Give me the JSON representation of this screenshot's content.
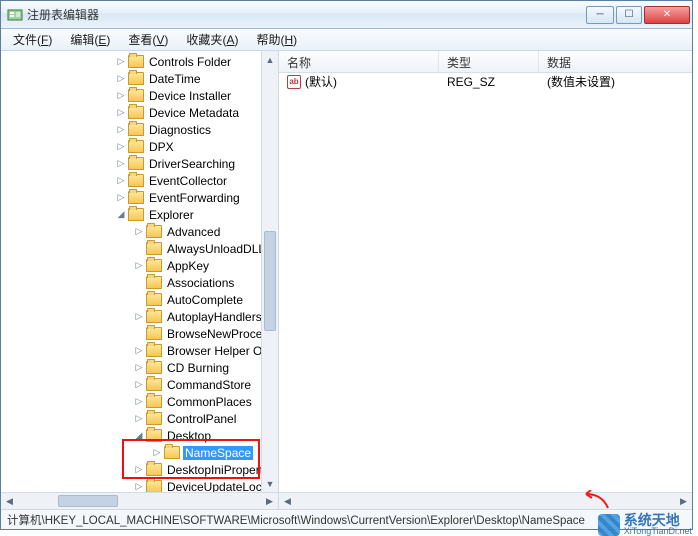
{
  "title": "注册表编辑器",
  "menu": {
    "file": {
      "label": "文件",
      "key": "F"
    },
    "edit": {
      "label": "编辑",
      "key": "E"
    },
    "view": {
      "label": "查看",
      "key": "V"
    },
    "fav": {
      "label": "收藏夹",
      "key": "A"
    },
    "help": {
      "label": "帮助",
      "key": "H"
    }
  },
  "columns": {
    "name": "名称",
    "type": "类型",
    "data": "数据"
  },
  "row0": {
    "name": "(默认)",
    "type": "REG_SZ",
    "data": "(数值未设置)",
    "icon": "ab"
  },
  "tree": {
    "items": [
      {
        "label": "Controls Folder",
        "exp": "▷"
      },
      {
        "label": "DateTime",
        "exp": "▷"
      },
      {
        "label": "Device Installer",
        "exp": "▷"
      },
      {
        "label": "Device Metadata",
        "exp": "▷"
      },
      {
        "label": "Diagnostics",
        "exp": "▷"
      },
      {
        "label": "DPX",
        "exp": "▷"
      },
      {
        "label": "DriverSearching",
        "exp": "▷"
      },
      {
        "label": "EventCollector",
        "exp": "▷"
      },
      {
        "label": "EventForwarding",
        "exp": "▷"
      },
      {
        "label": "Explorer",
        "exp": "◢",
        "expanded": true
      }
    ],
    "explorer_children": [
      {
        "label": "Advanced",
        "exp": "▷"
      },
      {
        "label": "AlwaysUnloadDLL",
        "exp": ""
      },
      {
        "label": "AppKey",
        "exp": "▷"
      },
      {
        "label": "Associations",
        "exp": ""
      },
      {
        "label": "AutoComplete",
        "exp": ""
      },
      {
        "label": "AutoplayHandlers",
        "exp": "▷"
      },
      {
        "label": "BrowseNewProcess",
        "exp": ""
      },
      {
        "label": "Browser Helper Ob",
        "exp": "▷"
      },
      {
        "label": "CD Burning",
        "exp": "▷"
      },
      {
        "label": "CommandStore",
        "exp": "▷"
      },
      {
        "label": "CommonPlaces",
        "exp": "▷"
      },
      {
        "label": "ControlPanel",
        "exp": "▷"
      },
      {
        "label": "Desktop",
        "exp": "◢",
        "expanded": true
      }
    ],
    "desktop_children": [
      {
        "label": "NameSpace",
        "exp": "▷",
        "selected": true
      }
    ],
    "after_desktop": [
      {
        "label": "DesktopIniProperty",
        "exp": "▷"
      },
      {
        "label": "DeviceUpdateLocati",
        "exp": "▷"
      }
    ]
  },
  "statusbar": "计算机\\HKEY_LOCAL_MACHINE\\SOFTWARE\\Microsoft\\Windows\\CurrentVersion\\Explorer\\Desktop\\NameSpace",
  "watermark": {
    "big": "系统天地",
    "small": "XiTongTianDi.net"
  }
}
